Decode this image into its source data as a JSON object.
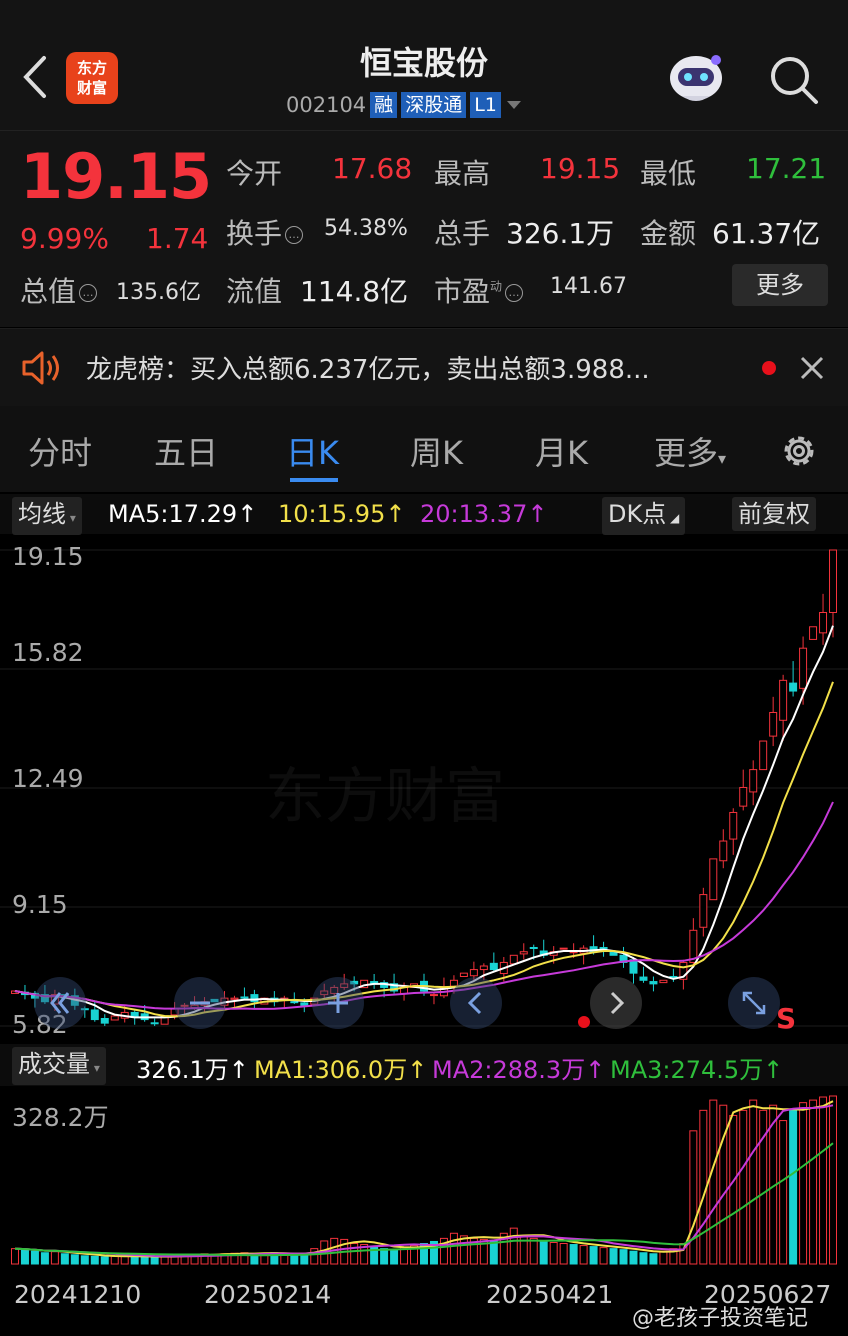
{
  "header": {
    "logo_line1": "东方",
    "logo_line2": "财富",
    "stock_name": "恒宝股份",
    "stock_code": "002104",
    "tags": [
      "融",
      "深股通",
      "L1"
    ]
  },
  "quote": {
    "price": "19.15",
    "change_pct": "9.99%",
    "change": "1.74",
    "open_label": "今开",
    "open_value": "17.68",
    "high_label": "最高",
    "high_value": "19.15",
    "low_label": "最低",
    "low_value": "17.21",
    "turnover_label": "换手",
    "turnover_value": "54.38%",
    "volume_label": "总手",
    "volume_value": "326.1万",
    "amount_label": "金额",
    "amount_value": "61.37亿",
    "mktcap_label": "总值",
    "mktcap_value": "135.6亿",
    "float_label": "流值",
    "float_value": "114.8亿",
    "pe_label": "市盈",
    "pe_sup": "动",
    "pe_value": "141.67",
    "more_label": "更多"
  },
  "notice": {
    "text": "龙虎榜：买入总额6.237亿元，卖出总额3.988..."
  },
  "tabs": [
    {
      "label": "分时",
      "active": false
    },
    {
      "label": "五日",
      "active": false
    },
    {
      "label": "日K",
      "active": true
    },
    {
      "label": "周K",
      "active": false
    },
    {
      "label": "月K",
      "active": false
    },
    {
      "label": "更多",
      "active": false
    }
  ],
  "ma_bar": {
    "selector": "均线",
    "ma5": "MA5:17.29↑",
    "ma10": "10:15.95↑",
    "ma20": "20:13.37↑",
    "dk_button": "DK点",
    "adjust_button": "前复权"
  },
  "vol_bar": {
    "selector": "成交量",
    "vol": "326.1万↑",
    "ma1": "MA1:306.0万↑",
    "ma2": "MA2:288.3万↑",
    "ma3": "MA3:274.5万↑"
  },
  "watermark": "东方财富",
  "weibo": "@老孩子投资笔记",
  "colors": {
    "up": "#f4333c",
    "down": "#19d3d3",
    "accent": "#3a8bf0",
    "ma5": "#ffffff",
    "ma10": "#f2e04a",
    "ma20": "#c63ad9"
  },
  "chart_data": {
    "type": "candlestick",
    "ylim": [
      5.82,
      19.15
    ],
    "y_ticks": [
      "19.15",
      "15.82",
      "12.49",
      "9.15",
      "5.82"
    ],
    "x_labels": [
      "20241210",
      "20250214",
      "20250421",
      "20250627"
    ],
    "sell_marker": "S",
    "close_series": [
      6.8,
      6.7,
      6.6,
      6.5,
      6.7,
      6.6,
      6.4,
      6.3,
      6.0,
      5.9,
      6.1,
      6.2,
      6.1,
      6.0,
      5.9,
      6.1,
      6.3,
      6.4,
      6.4,
      6.5,
      6.5,
      6.6,
      6.6,
      6.6,
      6.5,
      6.6,
      6.5,
      6.6,
      6.5,
      6.4,
      6.6,
      6.8,
      6.9,
      7.0,
      7.0,
      7.1,
      7.0,
      6.9,
      6.8,
      6.9,
      7.0,
      6.8,
      6.7,
      6.9,
      7.1,
      7.3,
      7.4,
      7.5,
      7.4,
      7.6,
      7.8,
      7.9,
      8.0,
      7.8,
      7.9,
      8.0,
      7.9,
      8.0,
      7.9,
      8.0,
      7.8,
      7.6,
      7.3,
      7.1,
      7.0,
      7.1,
      7.2,
      7.6,
      8.5,
      9.5,
      10.5,
      11.0,
      11.8,
      12.5,
      13.0,
      13.8,
      14.6,
      15.5,
      15.2,
      16.4,
      17.0,
      17.4,
      19.15
    ],
    "volume_max": "328.2万",
    "volume_series": [
      30,
      28,
      25,
      22,
      24,
      20,
      18,
      16,
      15,
      14,
      15,
      16,
      15,
      14,
      13,
      14,
      16,
      18,
      18,
      20,
      19,
      20,
      21,
      22,
      20,
      21,
      22,
      20,
      19,
      20,
      30,
      45,
      50,
      48,
      40,
      38,
      35,
      30,
      28,
      32,
      36,
      40,
      44,
      50,
      60,
      55,
      50,
      48,
      45,
      60,
      70,
      55,
      50,
      45,
      42,
      40,
      38,
      36,
      34,
      32,
      30,
      28,
      25,
      22,
      20,
      25,
      30,
      40,
      260,
      300,
      320,
      310,
      290,
      300,
      320,
      300,
      310,
      280,
      300,
      315,
      320,
      326,
      328
    ]
  }
}
